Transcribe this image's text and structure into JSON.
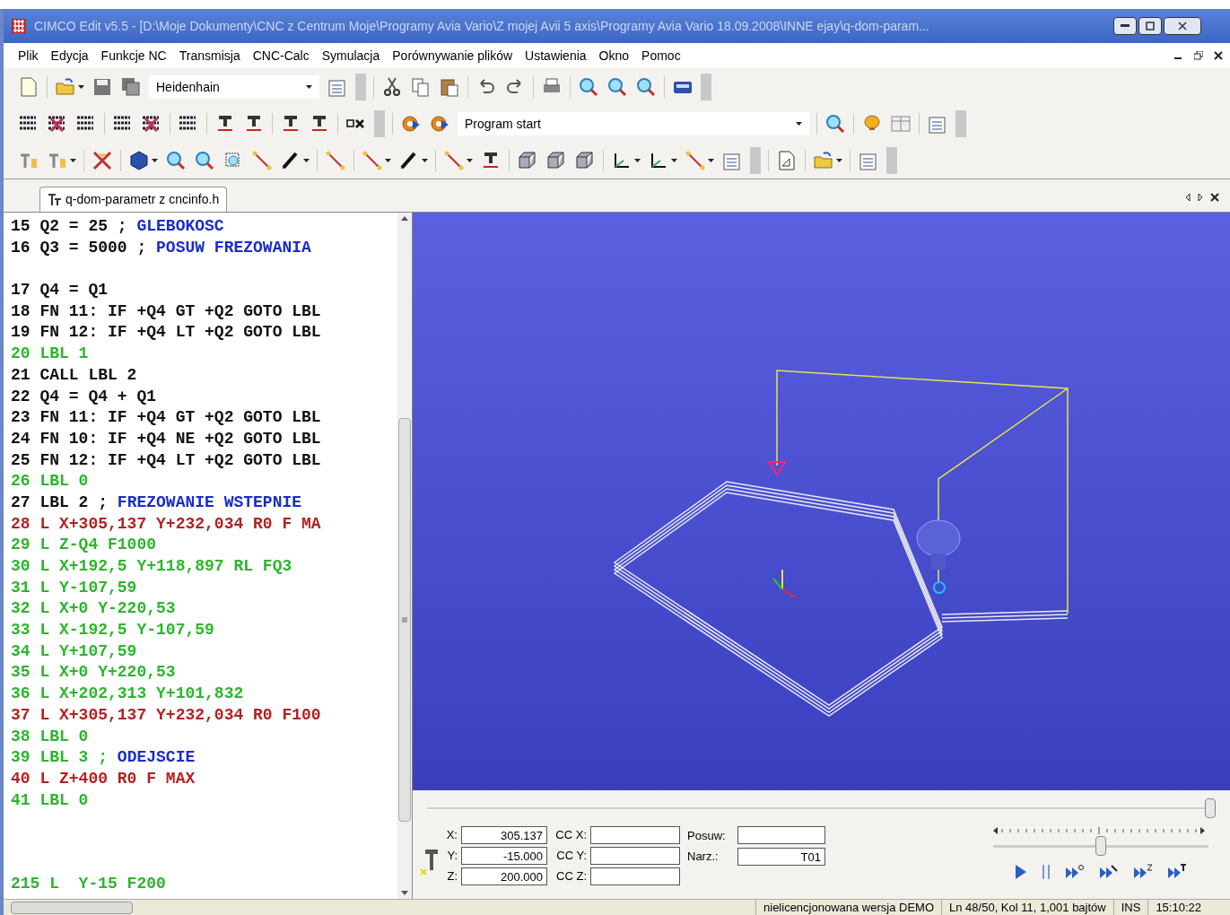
{
  "window": {
    "title": "CIMCO Edit v5.5 - [D:\\Moje Dokumenty\\CNC z Centrum Moje\\Programy Avia Vario\\Z mojej Avii 5 axis\\Programy Avia Vario 18.09.2008\\INNE ejay\\q-dom-param..."
  },
  "menu": [
    "Plik",
    "Edycja",
    "Funkcje NC",
    "Transmisja",
    "CNC-Calc",
    "Symulacja",
    "Porównywanie plików",
    "Ustawienia",
    "Okno",
    "Pomoc"
  ],
  "toolbar": {
    "machine_select": "Heidenhain",
    "program_select": "Program start"
  },
  "tabs": [
    {
      "label": "q-dom-parametr z cncinfo.h",
      "selected": true
    }
  ],
  "editor": {
    "lines": [
      {
        "code": "15 Q2 = 25 ; ",
        "comment": "GLEBOKOSC",
        "color": "#111111",
        "gap_before": false
      },
      {
        "code": "16 Q3 = 5000 ; ",
        "comment": "POSUW FREZOWANIA",
        "color": "#111111",
        "gap_before": false
      },
      {
        "code": "17 Q4 = Q1",
        "color": "#111111",
        "gap_before": true
      },
      {
        "code": "18 FN 11: IF +Q4 GT +Q2 GOTO LBL",
        "color": "#111111",
        "gap_before": false
      },
      {
        "code": "19 FN 12: IF +Q4 LT +Q2 GOTO LBL",
        "color": "#111111",
        "gap_before": false
      },
      {
        "code": "20 LBL 1",
        "color": "#2db52d",
        "gap_before": false
      },
      {
        "code": "21 CALL LBL 2",
        "color": "#111111",
        "gap_before": false
      },
      {
        "code": "22 Q4 = Q4 + Q1",
        "color": "#111111",
        "gap_before": false
      },
      {
        "code": "23 FN 11: IF +Q4 GT +Q2 GOTO LBL",
        "color": "#111111",
        "gap_before": false
      },
      {
        "code": "24 FN 10: IF +Q4 NE +Q2 GOTO LBL",
        "color": "#111111",
        "gap_before": false
      },
      {
        "code": "25 FN 12: IF +Q4 LT +Q2 GOTO LBL",
        "color": "#111111",
        "gap_before": false
      },
      {
        "code": "26 LBL 0",
        "color": "#2db52d",
        "gap_before": false
      },
      {
        "code": "27 LBL 2 ; ",
        "comment": "FREZOWANIE WSTEPNIE",
        "color": "#111111",
        "gap_before": false
      },
      {
        "code": "28 L X+305,137 Y+232,034 R0 F MA",
        "color": "#b22222",
        "gap_before": false
      },
      {
        "code": "29 L Z-Q4 F1000",
        "color": "#2db52d",
        "gap_before": false
      },
      {
        "code": "30 L X+192,5 Y+118,897 RL FQ3",
        "color": "#2db52d",
        "gap_before": false
      },
      {
        "code": "31 L Y-107,59",
        "color": "#2db52d",
        "gap_before": false
      },
      {
        "code": "32 L X+0 Y-220,53",
        "color": "#2db52d",
        "gap_before": false
      },
      {
        "code": "33 L X-192,5 Y-107,59",
        "color": "#2db52d",
        "gap_before": false
      },
      {
        "code": "34 L Y+107,59",
        "color": "#2db52d",
        "gap_before": false
      },
      {
        "code": "35 L X+0 Y+220,53",
        "color": "#2db52d",
        "gap_before": false
      },
      {
        "code": "36 L X+202,313 Y+101,832",
        "color": "#2db52d",
        "gap_before": false
      },
      {
        "code": "37 L X+305,137 Y+232,034 R0 F100",
        "color": "#b22222",
        "gap_before": false
      },
      {
        "code": "38 LBL 0",
        "color": "#2db52d",
        "gap_before": false
      },
      {
        "code": "39 LBL 3 ; ",
        "comment": "ODEJSCIE",
        "color": "#2db52d",
        "gap_before": false
      },
      {
        "code": "40 L Z+400 R0 F MAX",
        "color": "#b22222",
        "gap_before": false
      },
      {
        "code": "41 LBL 0",
        "color": "#2db52d",
        "gap_before": false
      }
    ],
    "last_line": {
      "code": "215 L  Y-15 F200",
      "color": "#2db52d"
    }
  },
  "simulation": {
    "progress": {
      "level": 1.0
    },
    "coords": [
      {
        "label": "X:",
        "value": "305.137",
        "cc_label": "CC X:"
      },
      {
        "label": "Y:",
        "value": "-15.000",
        "cc_label": "CC Y:"
      },
      {
        "label": "Z:",
        "value": "200.000",
        "cc_label": "CC Z:"
      }
    ],
    "feed": {
      "label": "Posuw:"
    },
    "tool": {
      "label": "Narz.:",
      "value": "T01"
    },
    "speed": {
      "level": 0.5
    }
  },
  "status_bar": [
    "nielicencjonowana wersja DEMO",
    "Ln 48/50, Kol 11, 1,001 bajtów",
    "INS",
    "15:10:22"
  ]
}
